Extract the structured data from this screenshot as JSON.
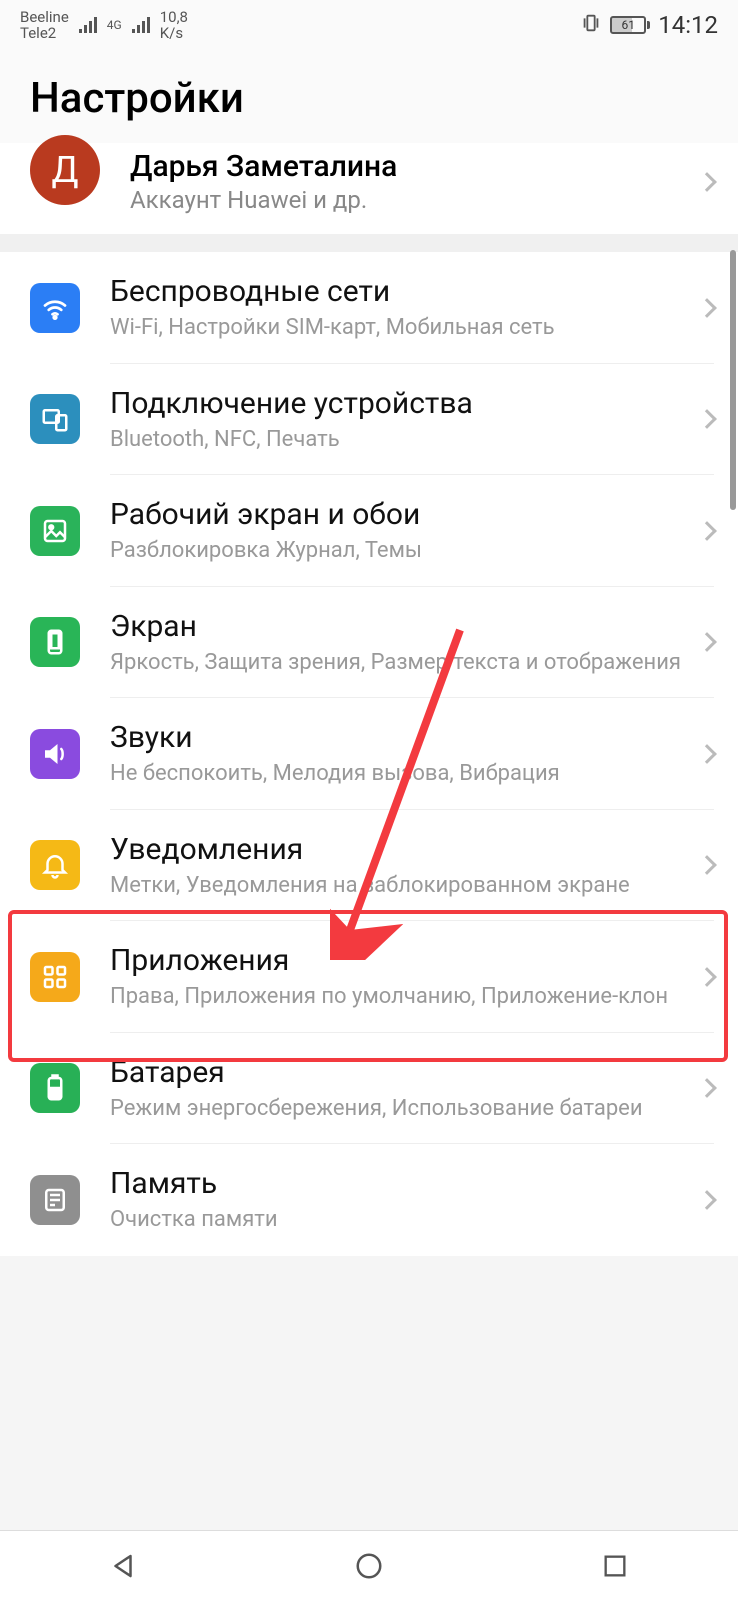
{
  "status": {
    "carrier1": "Beeline",
    "carrier2": "Tele2",
    "net_type": "4G",
    "speed_value": "10,8",
    "speed_unit": "K/s",
    "battery": "61",
    "time": "14:12"
  },
  "page_title": "Настройки",
  "account": {
    "avatar_letter": "Д",
    "name": "Дарья Заметалина",
    "sub": "Аккаунт Huawei и др."
  },
  "items": [
    {
      "title": "Беспроводные сети",
      "sub": "Wi-Fi, Настройки SIM-карт, Мобильная сеть",
      "icon": "wifi",
      "color": "ic-blue"
    },
    {
      "title": "Подключение устройства",
      "sub": "Bluetooth, NFC, Печать",
      "icon": "devices",
      "color": "ic-teal"
    },
    {
      "title": "Рабочий экран и обои",
      "sub": "Разблокировка Журнал, Темы",
      "icon": "image",
      "color": "ic-green"
    },
    {
      "title": "Экран",
      "sub": "Яркость, Защита зрения, Размер текста и отображения",
      "icon": "display",
      "color": "ic-green2"
    },
    {
      "title": "Звуки",
      "sub": "Не беспокоить, Мелодия вызова, Вибрация",
      "icon": "sound",
      "color": "ic-purple"
    },
    {
      "title": "Уведомления",
      "sub": "Метки, Уведомления на заблокированном экране",
      "icon": "bell",
      "color": "ic-yellow"
    },
    {
      "title": "Приложения",
      "sub": "Права, Приложения по умолчанию, Приложение-клон",
      "icon": "apps",
      "color": "ic-orange"
    },
    {
      "title": "Батарея",
      "sub": "Режим энергосбережения, Использование батареи",
      "icon": "battery",
      "color": "ic-green3"
    },
    {
      "title": "Память",
      "sub": "Очистка памяти",
      "icon": "storage",
      "color": "ic-gray"
    }
  ]
}
